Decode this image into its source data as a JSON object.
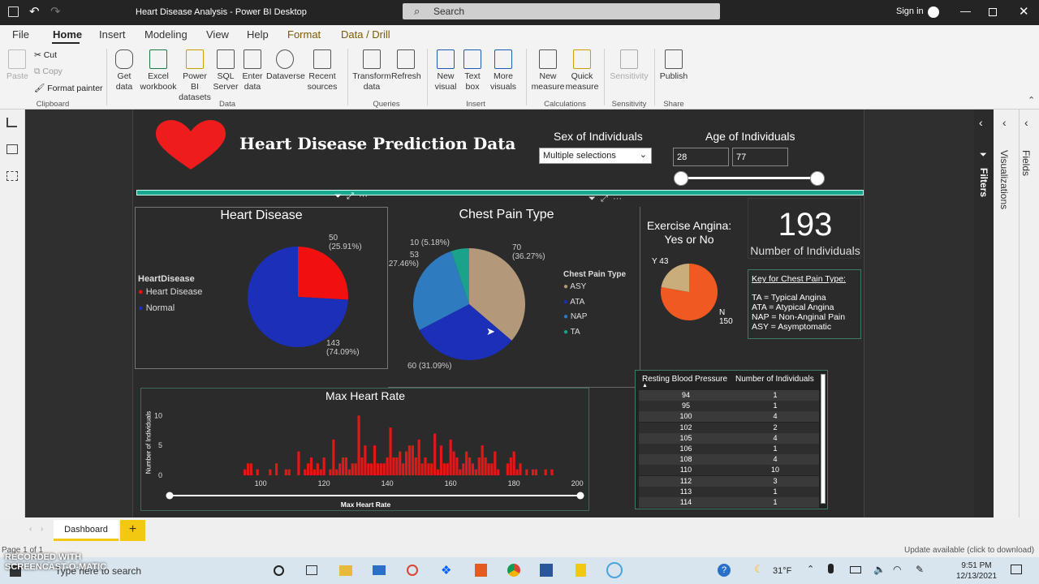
{
  "window": {
    "title": "Heart Disease Analysis - Power BI Desktop",
    "search_placeholder": "Search",
    "signin": "Sign in"
  },
  "menu": [
    "File",
    "Home",
    "Insert",
    "Modeling",
    "View",
    "Help",
    "Format",
    "Data / Drill"
  ],
  "ribbon": {
    "clipboard": {
      "paste": "Paste",
      "cut": "Cut",
      "copy": "Copy",
      "format_painter": "Format painter",
      "group": "Clipboard"
    },
    "data": {
      "get_data": "Get",
      "get_data2": "data",
      "excel": "Excel",
      "excel2": "workbook",
      "pbi": "Power BI",
      "pbi2": "datasets",
      "sql": "SQL",
      "sql2": "Server",
      "enter": "Enter",
      "enter2": "data",
      "dataverse": "Dataverse",
      "recent": "Recent",
      "recent2": "sources",
      "group": "Data"
    },
    "queries": {
      "transform": "Transform",
      "transform2": "data",
      "refresh": "Refresh",
      "group": "Queries"
    },
    "insert": {
      "new_visual": "New",
      "new_visual2": "visual",
      "text_box": "Text",
      "text_box2": "box",
      "more": "More",
      "more2": "visuals",
      "group": "Insert"
    },
    "calc": {
      "new_measure": "New",
      "new_measure2": "measure",
      "quick": "Quick",
      "quick2": "measure",
      "group": "Calculations"
    },
    "sens": {
      "label": "Sensitivity",
      "group": "Sensitivity"
    },
    "share": {
      "publish": "Publish",
      "group": "Share"
    }
  },
  "report": {
    "title": "Heart Disease Prediction Data",
    "sex_slicer": {
      "label": "Sex of Individuals",
      "value": "Multiple selections"
    },
    "age_slicer": {
      "label": "Age of Individuals",
      "min": "28",
      "max": "77",
      "range_low_pct": 0,
      "range_high_pct": 100
    },
    "card": {
      "value": "193",
      "label": "Number of Individuals"
    },
    "key": {
      "title": "Key for Chest Pain Type:",
      "lines": [
        "TA = Typical Angina",
        "ATA = Atypical Angina",
        "NAP = Non-Anginal Pain",
        "ASY = Asymptomatic"
      ]
    },
    "exercise_title1": "Exercise Angina:",
    "exercise_title2": "Yes or No",
    "bp_table": {
      "col1": "Resting Blood Pressure",
      "col2": "Number of Individuals",
      "rows": [
        [
          "94",
          "1"
        ],
        [
          "95",
          "1"
        ],
        [
          "100",
          "4"
        ],
        [
          "102",
          "2"
        ],
        [
          "105",
          "4"
        ],
        [
          "106",
          "1"
        ],
        [
          "108",
          "4"
        ],
        [
          "110",
          "10"
        ],
        [
          "112",
          "3"
        ],
        [
          "113",
          "1"
        ],
        [
          "114",
          "1"
        ]
      ]
    }
  },
  "chart_data": [
    {
      "type": "pie",
      "title": "Heart Disease",
      "legend_title": "HeartDisease",
      "legend_position": "left",
      "slices": [
        {
          "name": "Heart Disease",
          "value": 50,
          "label": "50",
          "pct": "(25.91%)",
          "color": "#f01010"
        },
        {
          "name": "Normal",
          "value": 143,
          "label": "143",
          "pct": "(74.09%)",
          "color": "#1c2fb8"
        }
      ]
    },
    {
      "type": "pie",
      "title": "Chest Pain Type",
      "legend_title": "Chest Pain Type",
      "legend_position": "right",
      "slices": [
        {
          "name": "ASY",
          "value": 70,
          "label": "70",
          "pct": "(36.27%)",
          "color": "#b4987a"
        },
        {
          "name": "ATA",
          "value": 60,
          "label": "60 (31.09%)",
          "pct": "",
          "color": "#1c2fb8"
        },
        {
          "name": "NAP",
          "value": 53,
          "label": "53",
          "pct": "27.46%)",
          "color": "#2f7bc0"
        },
        {
          "name": "TA",
          "value": 10,
          "label": "10 (5.18%)",
          "pct": "",
          "color": "#1aa38a"
        }
      ]
    },
    {
      "type": "pie",
      "title": "",
      "legend_position": "none",
      "slices": [
        {
          "name": "N",
          "value": 150,
          "label": "N",
          "label2": "150",
          "color": "#f05a22"
        },
        {
          "name": "Y",
          "value": 43,
          "label": "Y 43",
          "label2": "",
          "color": "#c9ad7a"
        }
      ]
    },
    {
      "type": "bar",
      "title": "Max Heart Rate",
      "xlabel": "Max Heart Rate",
      "ylabel": "Number of Individuals",
      "xlim": [
        71,
        202
      ],
      "ylim": [
        0,
        11
      ],
      "xticks": [
        "100",
        "120",
        "140",
        "160",
        "180",
        "200"
      ],
      "yticks": [
        "0",
        "5",
        "10"
      ],
      "x": [
        95,
        96,
        97,
        99,
        103,
        105,
        108,
        109,
        112,
        114,
        115,
        116,
        117,
        118,
        119,
        120,
        122,
        123,
        124,
        125,
        126,
        127,
        128,
        129,
        130,
        131,
        132,
        133,
        134,
        135,
        136,
        137,
        138,
        139,
        140,
        141,
        142,
        143,
        144,
        145,
        146,
        147,
        148,
        149,
        150,
        151,
        152,
        153,
        154,
        155,
        156,
        157,
        158,
        159,
        160,
        161,
        162,
        163,
        164,
        165,
        166,
        167,
        168,
        169,
        170,
        171,
        172,
        173,
        174,
        175,
        178,
        179,
        180,
        181,
        182,
        184,
        186,
        187,
        190,
        192
      ],
      "values": [
        1,
        2,
        2,
        1,
        1,
        2,
        1,
        1,
        4,
        1,
        2,
        3,
        1,
        2,
        1,
        3,
        1,
        6,
        1,
        2,
        3,
        3,
        1,
        2,
        2,
        10,
        3,
        5,
        2,
        2,
        5,
        2,
        2,
        2,
        3,
        8,
        3,
        3,
        4,
        2,
        4,
        5,
        5,
        3,
        6,
        2,
        3,
        2,
        2,
        7,
        1,
        5,
        2,
        2,
        6,
        4,
        3,
        1,
        2,
        4,
        3,
        2,
        1,
        3,
        5,
        3,
        2,
        2,
        4,
        1,
        2,
        3,
        4,
        1,
        2,
        1,
        1,
        1,
        1,
        1
      ]
    }
  ],
  "pages": {
    "tab": "Dashboard",
    "page_info": "Page 1 of 1",
    "update": "Update available (click to download)"
  },
  "taskbar": {
    "search": "Type here to search",
    "weather": "31°F",
    "time": "9:51 PM",
    "date": "12/13/2021"
  },
  "watermark": "RECORDED WITH SCREENCAST-O-MATIC",
  "panes": {
    "filters": "Filters",
    "visualizations": "Visualizations",
    "fields": "Fields"
  }
}
